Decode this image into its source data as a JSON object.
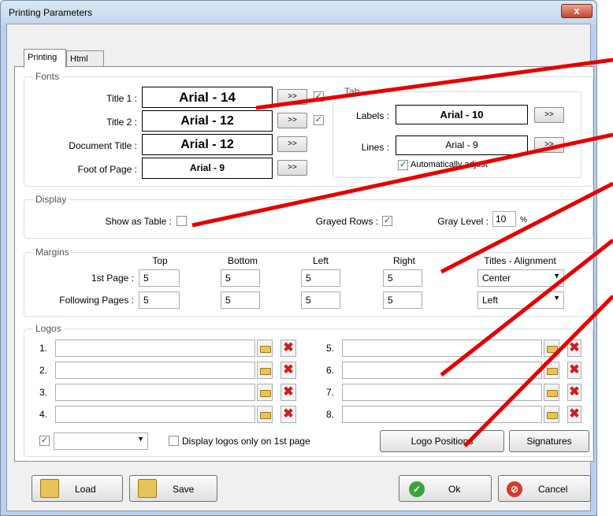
{
  "window": {
    "title": "Printing Parameters",
    "close_label": "x"
  },
  "tabs": [
    {
      "label": "Printing"
    },
    {
      "label": "Html"
    }
  ],
  "fonts": {
    "legend": "Fonts",
    "rows": [
      {
        "label": "Title 1 :",
        "value": "Arial - 14",
        "button": ">>",
        "checked": true
      },
      {
        "label": "Title 2 :",
        "value": "Arial - 12",
        "button": ">>",
        "checked": true
      },
      {
        "label": "Document Title :",
        "value": "Arial - 12",
        "button": ">>"
      },
      {
        "label": "Foot of Page :",
        "value": "Arial - 9",
        "button": ">>"
      }
    ],
    "tab": {
      "legend": "Tab",
      "labels_label": "Labels :",
      "labels_value": "Arial - 10",
      "lines_label": "Lines :",
      "lines_value": "Arial - 9",
      "button": ">>",
      "auto_label": "Automatically adjust",
      "auto_checked": true
    }
  },
  "display": {
    "legend": "Display",
    "show_table_label": "Show as Table :",
    "show_table_checked": false,
    "grayed_rows_label": "Grayed Rows :",
    "grayed_rows_checked": true,
    "gray_level_label": "Gray Level :",
    "gray_level_value": "10",
    "gray_level_unit": "%"
  },
  "margins": {
    "legend": "Margins",
    "columns": [
      "Top",
      "Bottom",
      "Left",
      "Right",
      "Titles - Alignment"
    ],
    "rows": [
      {
        "label": "1st Page :",
        "top": "5",
        "bottom": "5",
        "left": "5",
        "right": "5",
        "alignment": "Center"
      },
      {
        "label": "Following Pages :",
        "top": "5",
        "bottom": "5",
        "left": "5",
        "right": "5",
        "alignment": "Left"
      }
    ]
  },
  "logos": {
    "legend": "Logos",
    "numbers": [
      "1.",
      "2.",
      "3.",
      "4.",
      "5.",
      "6.",
      "7.",
      "8."
    ],
    "checkbox_checked": true,
    "dropdown_value": "",
    "only_first_label": "Display logos only on 1st page",
    "only_first_checked": false,
    "positions_button": "Logo Positions",
    "signatures_button": "Signatures"
  },
  "footer": {
    "load": "Load",
    "save": "Save",
    "ok": "Ok",
    "cancel": "Cancel"
  },
  "colors": {
    "annotation": "#e60000",
    "ok_green": "#3aa53a",
    "cancel_red": "#d9382a"
  }
}
